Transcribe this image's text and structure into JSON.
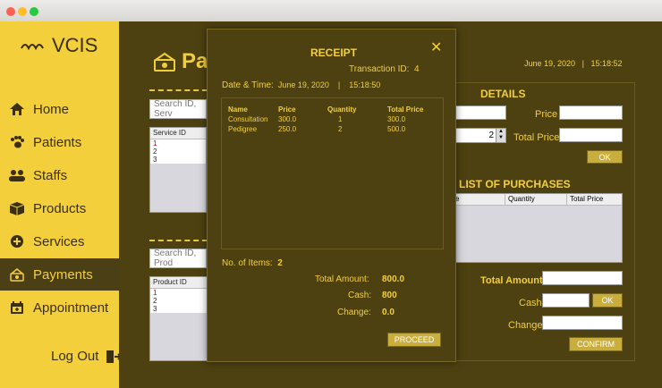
{
  "app": {
    "logo_text": "VCIS"
  },
  "sidebar": {
    "items": [
      {
        "label": "Home"
      },
      {
        "label": "Patients"
      },
      {
        "label": "Staffs"
      },
      {
        "label": "Products"
      },
      {
        "label": "Services"
      },
      {
        "label": "Payments"
      },
      {
        "label": "Appointment"
      }
    ],
    "logout": "Log Out"
  },
  "main": {
    "title": "Pay",
    "date": "June 19, 2020",
    "separator": "|",
    "time": "15:18:52",
    "service_search_placeholder": "Search ID, Serv",
    "service_table": {
      "header": "Service ID",
      "rows": [
        "1",
        "2",
        "3"
      ]
    },
    "product_search_placeholder": "Search ID, Prod",
    "product_table": {
      "header": "Product ID",
      "rows": [
        "1",
        "2",
        "3"
      ]
    },
    "details_title": "DETAILS",
    "price_label": "Price",
    "total_price_label": "Total Price",
    "quantity_value": "2",
    "ok_label": "OK",
    "list_title": "LIST OF PURCHASES",
    "list_columns": [
      "e",
      "Quantity",
      "Total Price"
    ],
    "total_amount_label": "Total Amount",
    "cash_label": "Cash",
    "change_label": "Change",
    "confirm_label": "CONFIRM"
  },
  "receipt": {
    "title": "RECEIPT",
    "close": "✕",
    "transaction_label": "Transaction ID:",
    "transaction_id": "4",
    "datetime_label": "Date & Time:",
    "date": "June 19, 2020",
    "separator": "|",
    "time": "15:18:50",
    "columns": [
      "Name",
      "Price",
      "Quantity",
      "Total Price"
    ],
    "items": [
      {
        "name": "Consultation",
        "price": "300.0",
        "quantity": "1",
        "total": "300.0"
      },
      {
        "name": "Pedigree",
        "price": "250.0",
        "quantity": "2",
        "total": "500.0"
      }
    ],
    "items_label": "No. of Items:",
    "items_count": "2",
    "total_amount_label": "Total Amount:",
    "total_amount": "800.0",
    "cash_label": "Cash:",
    "cash": "800",
    "change_label": "Change:",
    "change": "0.0",
    "proceed_label": "PROCEED"
  },
  "colors": {
    "accent": "#f3cf3c",
    "dark": "#4d4111"
  }
}
